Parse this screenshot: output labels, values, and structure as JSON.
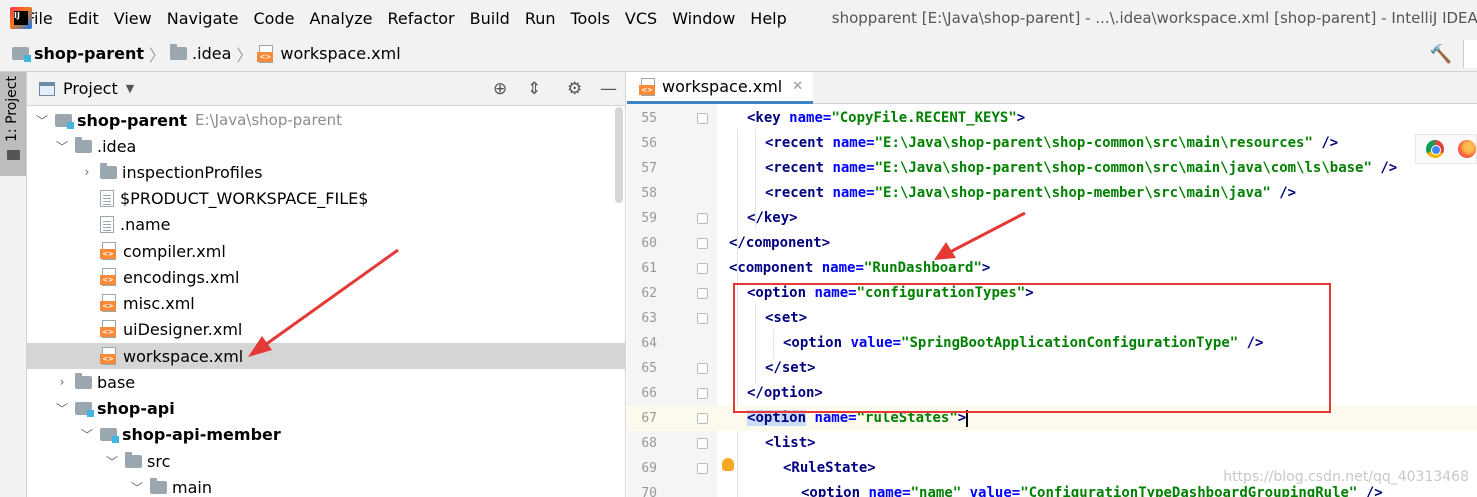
{
  "menu": {
    "items": [
      "File",
      "Edit",
      "View",
      "Navigate",
      "Code",
      "Analyze",
      "Refactor",
      "Build",
      "Run",
      "Tools",
      "VCS",
      "Window",
      "Help"
    ],
    "window_title": "shopparent [E:\\Java\\shop-parent] - ...\\.idea\\workspace.xml [shop-parent] - IntelliJ IDEA"
  },
  "breadcrumb": {
    "items": [
      "shop-parent",
      ".idea",
      "workspace.xml"
    ]
  },
  "left_strip": {
    "project_tab": "1: Project"
  },
  "project_panel": {
    "title": "Project",
    "tree": [
      {
        "label": "shop-parent",
        "path": "E:\\Java\\shop-parent"
      },
      {
        "label": ".idea"
      },
      {
        "label": "inspectionProfiles"
      },
      {
        "label": "$PRODUCT_WORKSPACE_FILE$"
      },
      {
        "label": ".name"
      },
      {
        "label": "compiler.xml"
      },
      {
        "label": "encodings.xml"
      },
      {
        "label": "misc.xml"
      },
      {
        "label": "uiDesigner.xml"
      },
      {
        "label": "workspace.xml",
        "selected": true
      },
      {
        "label": "base"
      },
      {
        "label": "shop-api"
      },
      {
        "label": "shop-api-member"
      },
      {
        "label": "src"
      },
      {
        "label": "main"
      }
    ]
  },
  "editor": {
    "tab_label": "workspace.xml",
    "line_numbers": [
      "55",
      "56",
      "57",
      "58",
      "59",
      "60",
      "61",
      "62",
      "63",
      "64",
      "65",
      "66",
      "67",
      "68",
      "69",
      "70"
    ],
    "code": {
      "l55": {
        "tag": "<key",
        "attr": "name=",
        "val": "\"CopyFile.RECENT_KEYS\"",
        "end": ">"
      },
      "l56": {
        "tag": "<recent",
        "attr": "name=",
        "val": "\"E:\\Java\\shop-parent\\shop-common\\src\\main\\resources\"",
        "end": " />"
      },
      "l57": {
        "tag": "<recent",
        "attr": "name=",
        "val": "\"E:\\Java\\shop-parent\\shop-common\\src\\main\\java\\com\\ls\\base\"",
        "end": " />"
      },
      "l58": {
        "tag": "<recent",
        "attr": "name=",
        "val": "\"E:\\Java\\shop-parent\\shop-member\\src\\main\\java\"",
        "end": " />"
      },
      "l59": {
        "tag": "</key>"
      },
      "l60": {
        "tag": "</component>"
      },
      "l61": {
        "tag": "<component",
        "attr": "name=",
        "val": "\"RunDashboard\"",
        "end": ">"
      },
      "l62": {
        "tag": "<option",
        "attr": "name=",
        "val": "\"configurationTypes\"",
        "end": ">"
      },
      "l63": {
        "tag": "<set>"
      },
      "l64": {
        "tag": "<option",
        "attr": "value=",
        "val": "\"SpringBootApplicationConfigurationType\"",
        "end": " />"
      },
      "l65": {
        "tag": "</set>"
      },
      "l66": {
        "tag": "</option>"
      },
      "l67": {
        "lt": "<",
        "tag": "option",
        "attr": "name=",
        "val": "\"ruleStates\"",
        "end": ">"
      },
      "l68": {
        "tag": "<list>"
      },
      "l69": {
        "tag": "<RuleState>"
      },
      "l70": {
        "tag": "<option",
        "attr": "name=",
        "val": "\"name\"",
        "attr2": "value=",
        "val2": "\"ConfigurationTypeDashboardGroupingRule\"",
        "end": " />"
      }
    }
  },
  "watermark": "https://blog.csdn.net/qq_40313468",
  "colors": {
    "tag": "#000080",
    "attribute": "#0000ff",
    "string": "#008000",
    "annotation": "#e53935",
    "selection": "#d5d5d5"
  }
}
